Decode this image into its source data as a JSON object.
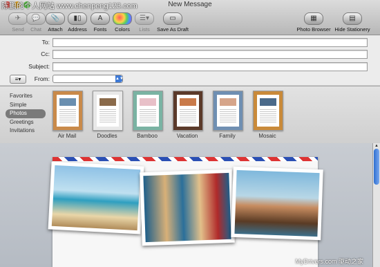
{
  "watermark_top": "陈鹏的个人网站 www.chenpeng123.com",
  "window_title": "New Message",
  "toolbar": {
    "send": "Send",
    "chat": "Chat",
    "attach": "Attach",
    "address": "Address",
    "fonts": "Fonts",
    "colors": "Colors",
    "lists": "Lists",
    "save_draft": "Save As Draft",
    "photo_browser": "Photo Browser",
    "hide_stationery": "Hide Stationery"
  },
  "fields": {
    "to_label": "To:",
    "cc_label": "Cc:",
    "subject_label": "Subject:",
    "from_label": "From:",
    "options_glyph": "≡▾"
  },
  "categories": [
    "Favorites",
    "Simple",
    "Photos",
    "Greetings",
    "Invitations"
  ],
  "selected_category": "Photos",
  "stationery": [
    {
      "label": "Air Mail",
      "frame": "#c98a4a",
      "pic": "#6a8fb0"
    },
    {
      "label": "Doodles",
      "frame": "#e8e8e8",
      "pic": "#8a6a4a"
    },
    {
      "label": "Bamboo",
      "frame": "#7ab3a3",
      "pic": "#e8c0c8"
    },
    {
      "label": "Vacation",
      "frame": "#5b3a2a",
      "pic": "#c97a4a"
    },
    {
      "label": "Family",
      "frame": "#6f8fb2",
      "pic": "#d6a58a"
    },
    {
      "label": "Mosaic",
      "frame": "#c98a3a",
      "pic": "#4a6a8a"
    }
  ],
  "watermark_bottom": "MyDrivers.com 驱动之家",
  "colors": {
    "accent": "#3d79d6",
    "airmail_red": "#dd3333",
    "airmail_blue": "#2a4fb4"
  }
}
